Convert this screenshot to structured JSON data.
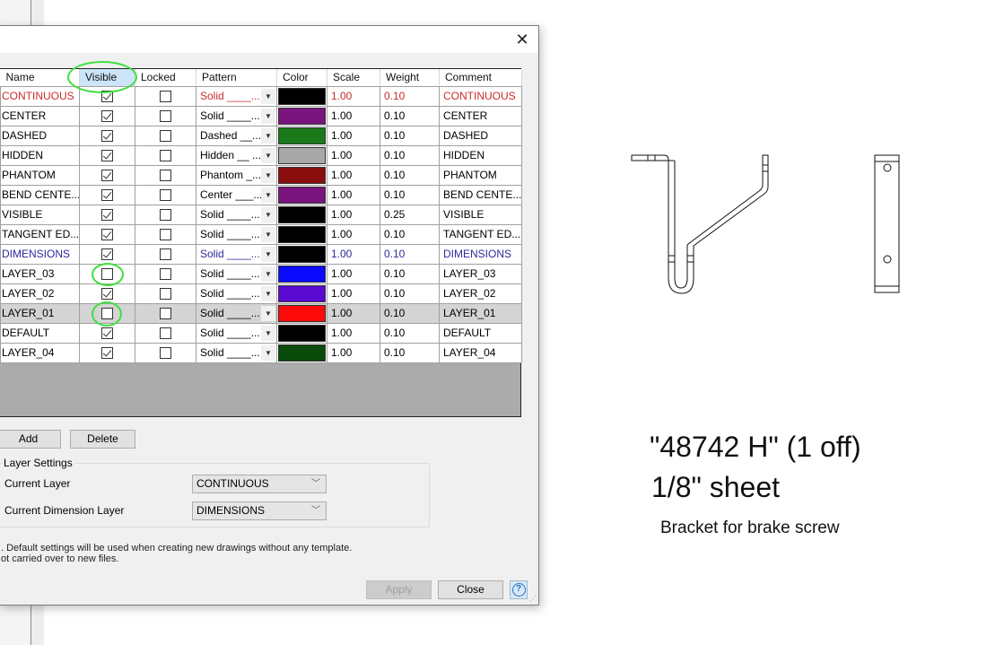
{
  "dialog": {
    "close_label": "✕",
    "columns": [
      "Name",
      "Visible",
      "Locked",
      "Pattern",
      "Color",
      "Scale",
      "Weight",
      "Comment"
    ],
    "layers": [
      {
        "name": "CONTINUOUS",
        "visible": true,
        "locked": false,
        "pattern": "Solid ____...",
        "color": "#000000",
        "scale": "1.00",
        "weight": "0.10",
        "comment": "CONTINUOUS",
        "style": "red"
      },
      {
        "name": "CENTER",
        "visible": true,
        "locked": false,
        "pattern": "Solid ____...",
        "color": "#7a147f",
        "scale": "1.00",
        "weight": "0.10",
        "comment": "CENTER",
        "style": ""
      },
      {
        "name": "DASHED",
        "visible": true,
        "locked": false,
        "pattern": "Dashed __...",
        "color": "#1a7a1a",
        "scale": "1.00",
        "weight": "0.10",
        "comment": "DASHED",
        "style": ""
      },
      {
        "name": "HIDDEN",
        "visible": true,
        "locked": false,
        "pattern": "Hidden __ ...",
        "color": "#a8a8a8",
        "scale": "1.00",
        "weight": "0.10",
        "comment": "HIDDEN",
        "style": ""
      },
      {
        "name": "PHANTOM",
        "visible": true,
        "locked": false,
        "pattern": "Phantom _...",
        "color": "#8b0e0e",
        "scale": "1.00",
        "weight": "0.10",
        "comment": "PHANTOM",
        "style": ""
      },
      {
        "name": "BEND CENTE...",
        "visible": true,
        "locked": false,
        "pattern": "Center ___...",
        "color": "#7a147f",
        "scale": "1.00",
        "weight": "0.10",
        "comment": "BEND CENTE...",
        "style": ""
      },
      {
        "name": "VISIBLE",
        "visible": true,
        "locked": false,
        "pattern": "Solid ____...",
        "color": "#000000",
        "scale": "1.00",
        "weight": "0.25",
        "comment": "VISIBLE",
        "style": ""
      },
      {
        "name": "TANGENT ED...",
        "visible": true,
        "locked": false,
        "pattern": "Solid ____...",
        "color": "#000000",
        "scale": "1.00",
        "weight": "0.10",
        "comment": "TANGENT ED...",
        "style": ""
      },
      {
        "name": "DIMENSIONS",
        "visible": true,
        "locked": false,
        "pattern": "Solid ____...",
        "color": "#000000",
        "scale": "1.00",
        "weight": "0.10",
        "comment": "DIMENSIONS",
        "style": "blue"
      },
      {
        "name": "LAYER_03",
        "visible": false,
        "locked": false,
        "pattern": "Solid ____...",
        "color": "#0a0aff",
        "scale": "1.00",
        "weight": "0.10",
        "comment": "LAYER_03",
        "style": ""
      },
      {
        "name": "LAYER_02",
        "visible": true,
        "locked": false,
        "pattern": "Solid ____...",
        "color": "#5a0ad0",
        "scale": "1.00",
        "weight": "0.10",
        "comment": "LAYER_02",
        "style": ""
      },
      {
        "name": "LAYER_01",
        "visible": false,
        "locked": false,
        "pattern": "Solid ____...",
        "color": "#ff0a0a",
        "scale": "1.00",
        "weight": "0.10",
        "comment": "LAYER_01",
        "style": "selected"
      },
      {
        "name": "DEFAULT",
        "visible": true,
        "locked": false,
        "pattern": "Solid ____...",
        "color": "#000000",
        "scale": "1.00",
        "weight": "0.10",
        "comment": "DEFAULT",
        "style": ""
      },
      {
        "name": "LAYER_04",
        "visible": true,
        "locked": false,
        "pattern": "Solid ____...",
        "color": "#0a4a0a",
        "scale": "1.00",
        "weight": "0.10",
        "comment": "LAYER_04",
        "style": ""
      }
    ],
    "add_label": "Add",
    "delete_label": "Delete",
    "layer_settings": {
      "title": "Layer Settings",
      "current_layer_label": "Current Layer",
      "current_layer_value": "CONTINUOUS",
      "current_dim_label": "Current Dimension Layer",
      "current_dim_value": "DIMENSIONS"
    },
    "note_line1": ". Default settings will be used when creating new drawings without any template.",
    "note_line2": "ot carried over to new files.",
    "apply_label": "Apply",
    "close_button_label": "Close",
    "help_label": "?"
  },
  "drawing": {
    "title": "\"48742 H\" (1 off)",
    "material": "1/8\" sheet",
    "description": "Bracket for brake screw"
  }
}
